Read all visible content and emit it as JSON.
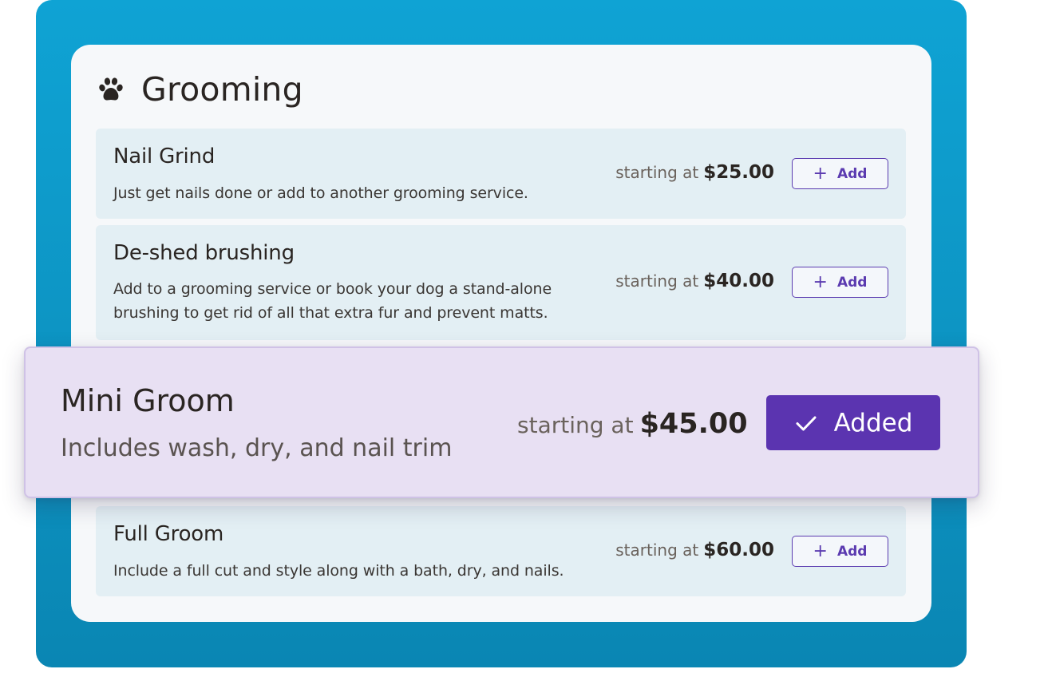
{
  "card": {
    "title": "Grooming",
    "icon": "paw-icon"
  },
  "services": [
    {
      "name": "Nail Grind",
      "description": "Just get nails done or add to another grooming service.",
      "price_prefix": "starting at",
      "price": "$25.00",
      "button_label": "Add",
      "button_icon": "plus-icon"
    },
    {
      "name": "De-shed brushing",
      "description": "Add to a grooming service or book your dog a stand-alone brushing to get rid of all that extra fur and prevent matts.",
      "price_prefix": "starting at",
      "price": "$40.00",
      "button_label": "Add",
      "button_icon": "plus-icon"
    },
    {
      "name": "Full Groom",
      "description": "Include a full cut and style along with a bath, dry, and nails.",
      "price_prefix": "starting at",
      "price": "$60.00",
      "button_label": "Add",
      "button_icon": "plus-icon"
    }
  ],
  "featured": {
    "name": "Mini Groom",
    "description": "Includes wash, dry, and nail trim",
    "price_prefix": "starting at",
    "price": "$45.00",
    "button_label": "Added",
    "button_icon": "checkmark-icon",
    "state": "added"
  },
  "colors": {
    "backdrop": "#0fa3d4",
    "card": "#f6f8fa",
    "row": "#e3eff4",
    "accent": "#5b34b0",
    "featured_bg": "#e8e0f3"
  }
}
